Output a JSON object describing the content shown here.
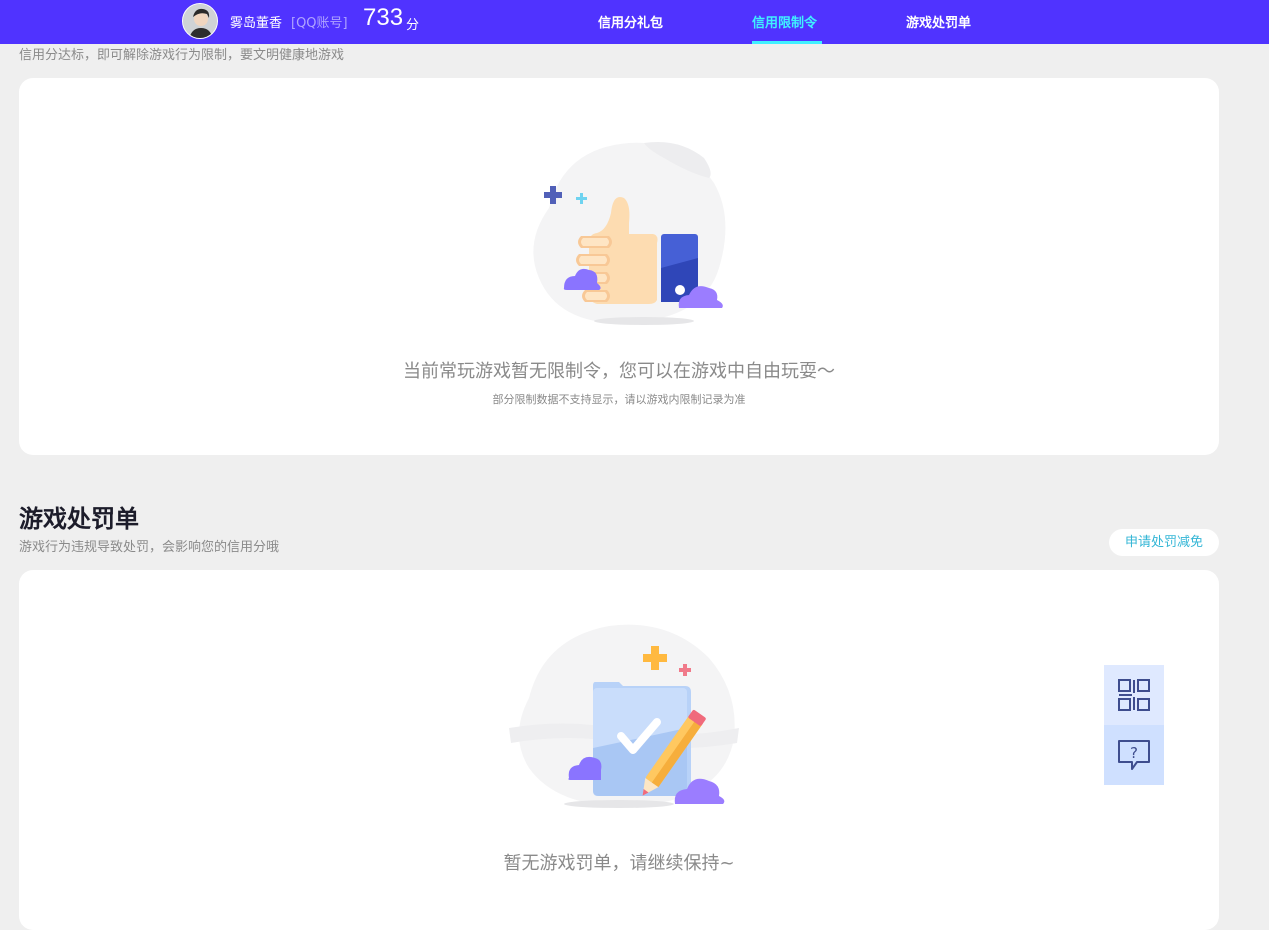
{
  "header": {
    "username": "雾岛董香",
    "account_type": "[QQ账号]",
    "score": "733",
    "score_unit": "分",
    "tabs": [
      {
        "label": "信用分礼包",
        "active": false
      },
      {
        "label": "信用限制令",
        "active": true
      },
      {
        "label": "游戏处罚单",
        "active": false
      }
    ],
    "accent": "#5033ff",
    "active_color": "#3ff0ff"
  },
  "restrictions": {
    "subtitle": "信用分达标，即可解除游戏行为限制，要文明健康地游戏",
    "empty_message": "当前常玩游戏暂无限制令，您可以在游戏中自由玩耍～",
    "empty_note": "部分限制数据不支持显示，请以游戏内限制记录为准",
    "illustration_icon": "thumbs-up-icon"
  },
  "penalties": {
    "title": "游戏处罚单",
    "subtitle": "游戏行为违规导致处罚，会影响您的信用分哦",
    "reduce_button": "申请处罚减免",
    "empty_message": "暂无游戏罚单，请继续保持~",
    "illustration_icon": "checklist-pencil-icon"
  },
  "float_panel": {
    "qr_icon": "qr-code-icon",
    "help_icon": "help-chat-icon"
  }
}
